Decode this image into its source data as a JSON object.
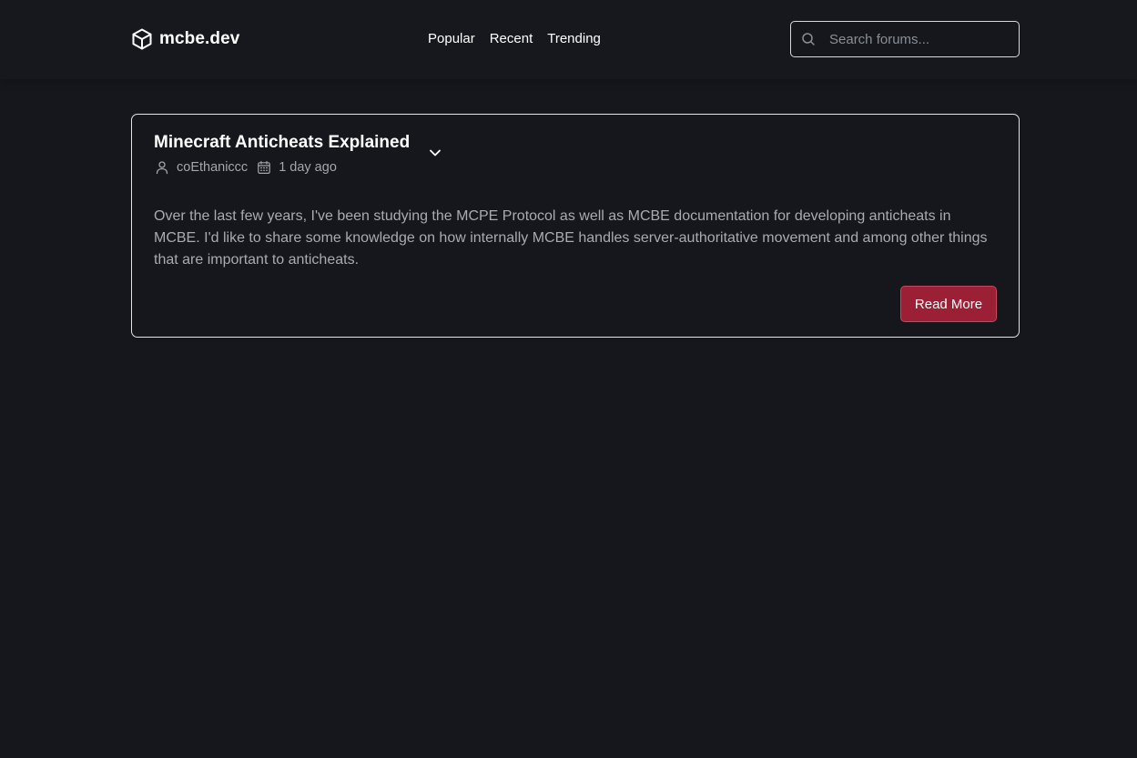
{
  "header": {
    "brand_name": "mcbe.dev",
    "brand_icon": "cube-icon",
    "nav": [
      {
        "label": "Popular"
      },
      {
        "label": "Recent"
      },
      {
        "label": "Trending"
      }
    ],
    "search": {
      "placeholder": "Search forums...",
      "value": "",
      "icon": "search-icon"
    }
  },
  "post": {
    "title": "Minecraft Anticheats Explained",
    "author": "coEthaniccc",
    "posted": "1 day ago",
    "excerpt": "Over the last few years, I've been studying the MCPE Protocol as well as MCBE documentation for developing anticheats in MCBE. I'd like to share some knowledge on how internally MCBE handles server-authoritative movement and among other things that are important to anticheats.",
    "read_more_label": "Read More"
  },
  "colors": {
    "background": "#15171c",
    "accent": "#9b1f35",
    "text_muted": "#a8abb2"
  }
}
